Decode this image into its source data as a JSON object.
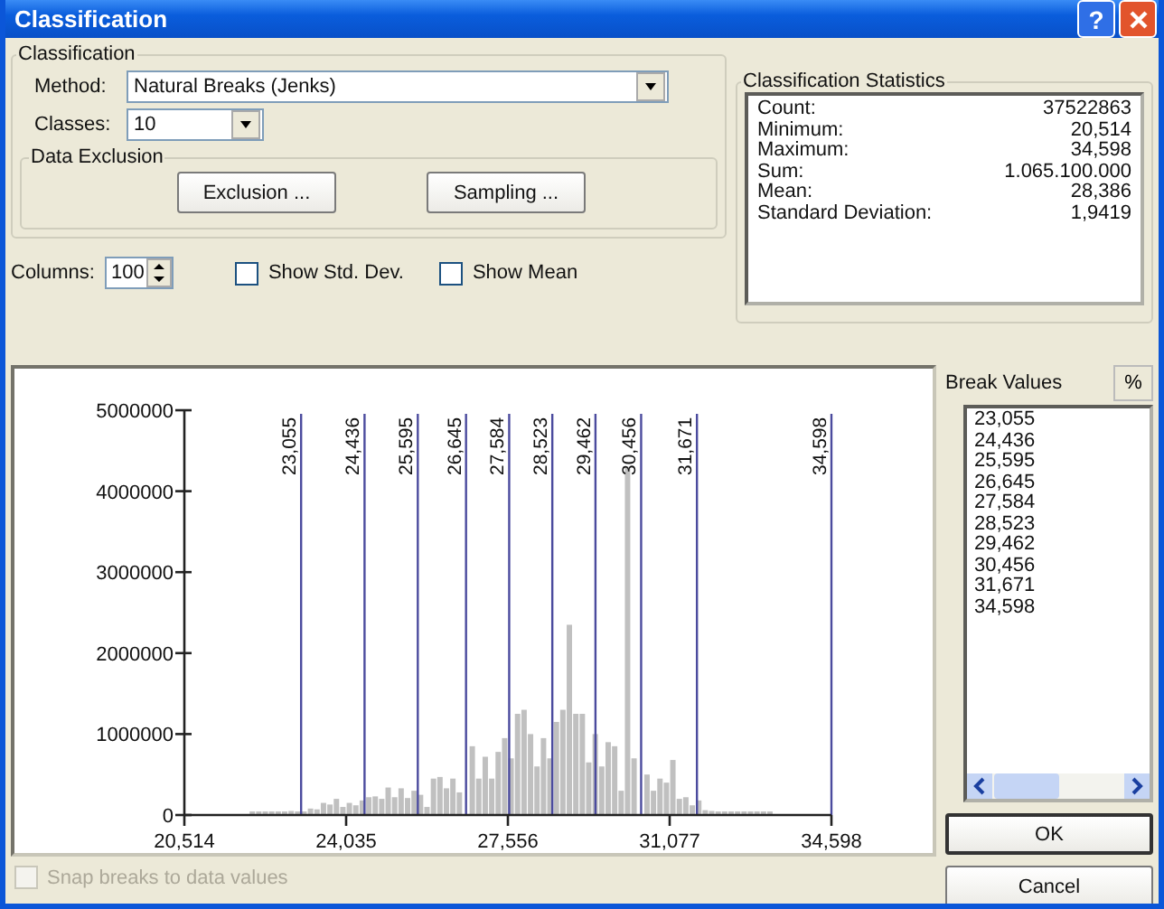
{
  "window": {
    "title": "Classification",
    "help_button": "?"
  },
  "classification": {
    "title": "Classification",
    "method_label": "Method:",
    "method": "Natural Breaks (Jenks)",
    "classes_label": "Classes:",
    "classes": "10"
  },
  "data_exclusion": {
    "title": "Data Exclusion",
    "buttons": [
      "Exclusion ...",
      "Sampling ..."
    ]
  },
  "statistics": {
    "title": "Classification Statistics",
    "rows": [
      {
        "label": "Count:",
        "value": "37522863"
      },
      {
        "label": "Minimum:",
        "value": "20,514"
      },
      {
        "label": "Maximum:",
        "value": "34,598"
      },
      {
        "label": "Sum:",
        "value": "1.065.100.000"
      },
      {
        "label": "Mean:",
        "value": "28,386"
      },
      {
        "label": "Standard Deviation:",
        "value": "1,9419"
      }
    ]
  },
  "columns": {
    "label": "Columns:",
    "value": "100"
  },
  "options": [
    {
      "label": "Show Std. Dev.",
      "checked": false
    },
    {
      "label": "Show Mean",
      "checked": false
    }
  ],
  "histogram": {
    "chart_data": {
      "type": "bar",
      "xlim": [
        20514,
        34598
      ],
      "ylim": [
        0,
        5000000
      ],
      "x": [
        21993,
        22134,
        22275,
        22415,
        22556,
        22697,
        22838,
        22979,
        23120,
        23260,
        23401,
        23542,
        23683,
        23824,
        23965,
        24105,
        24246,
        24387,
        24528,
        24669,
        24810,
        24950,
        25091,
        25232,
        25373,
        25514,
        25655,
        25795,
        25936,
        26077,
        26218,
        26359,
        26500,
        26781,
        26922,
        27063,
        27204,
        27345,
        27486,
        27626,
        27767,
        27908,
        28049,
        28190,
        28331,
        28471,
        28612,
        28753,
        28894,
        29035,
        29176,
        29316,
        29457,
        29598,
        29739,
        29880,
        30021,
        30161,
        30302,
        30584,
        30725,
        30866,
        31007,
        31147,
        31288,
        31429,
        31570,
        31711,
        31852,
        31992,
        32133,
        32274,
        32415,
        32556,
        32697,
        32837,
        32978,
        33119,
        33260
      ],
      "values": [
        40000,
        30000,
        20000,
        20000,
        20000,
        20000,
        50000,
        20000,
        20000,
        80000,
        70000,
        150000,
        130000,
        200000,
        100000,
        150000,
        120000,
        180000,
        220000,
        230000,
        200000,
        340000,
        220000,
        330000,
        210000,
        300000,
        250000,
        100000,
        450000,
        470000,
        330000,
        450000,
        280000,
        850000,
        450000,
        720000,
        450000,
        780000,
        950000,
        700000,
        1250000,
        1300000,
        1000000,
        600000,
        950000,
        700000,
        1150000,
        1300000,
        2350000,
        1250000,
        1250000,
        650000,
        1000000,
        600000,
        900000,
        850000,
        300000,
        4300000,
        700000,
        500000,
        300000,
        450000,
        400000,
        680000,
        200000,
        220000,
        120000,
        180000,
        60000,
        50000,
        30000,
        30000,
        20000,
        20000,
        20000,
        20000,
        20000,
        20000,
        20000
      ],
      "xticks": [
        {
          "value": 20514,
          "label": "20,514"
        },
        {
          "value": 24035,
          "label": "24,035"
        },
        {
          "value": 27556,
          "label": "27,556"
        },
        {
          "value": 31077,
          "label": "31,077"
        },
        {
          "value": 34598,
          "label": "34,598"
        }
      ],
      "yticks": [
        0,
        1000000,
        2000000,
        3000000,
        4000000,
        5000000
      ],
      "ref_lines": [
        {
          "axis": "x",
          "value": 23055,
          "label": "23,055"
        },
        {
          "axis": "x",
          "value": 24436,
          "label": "24,436"
        },
        {
          "axis": "x",
          "value": 25595,
          "label": "25,595"
        },
        {
          "axis": "x",
          "value": 26645,
          "label": "26,645"
        },
        {
          "axis": "x",
          "value": 27584,
          "label": "27,584"
        },
        {
          "axis": "x",
          "value": 28523,
          "label": "28,523"
        },
        {
          "axis": "x",
          "value": 29462,
          "label": "29,462"
        },
        {
          "axis": "x",
          "value": 30456,
          "label": "30,456"
        },
        {
          "axis": "x",
          "value": 31671,
          "label": "31,671"
        },
        {
          "axis": "x",
          "value": 34598,
          "label": "34,598"
        }
      ]
    }
  },
  "snap": {
    "label": "Snap breaks to data values",
    "checked": false,
    "disabled": true
  },
  "break_values": {
    "title": "Break Values",
    "percent_button": "%",
    "values": [
      "23,055",
      "24,436",
      "25,595",
      "26,645",
      "27,584",
      "28,523",
      "29,462",
      "30,456",
      "31,671",
      "34,598"
    ]
  },
  "buttons": [
    "OK",
    "Cancel"
  ]
}
